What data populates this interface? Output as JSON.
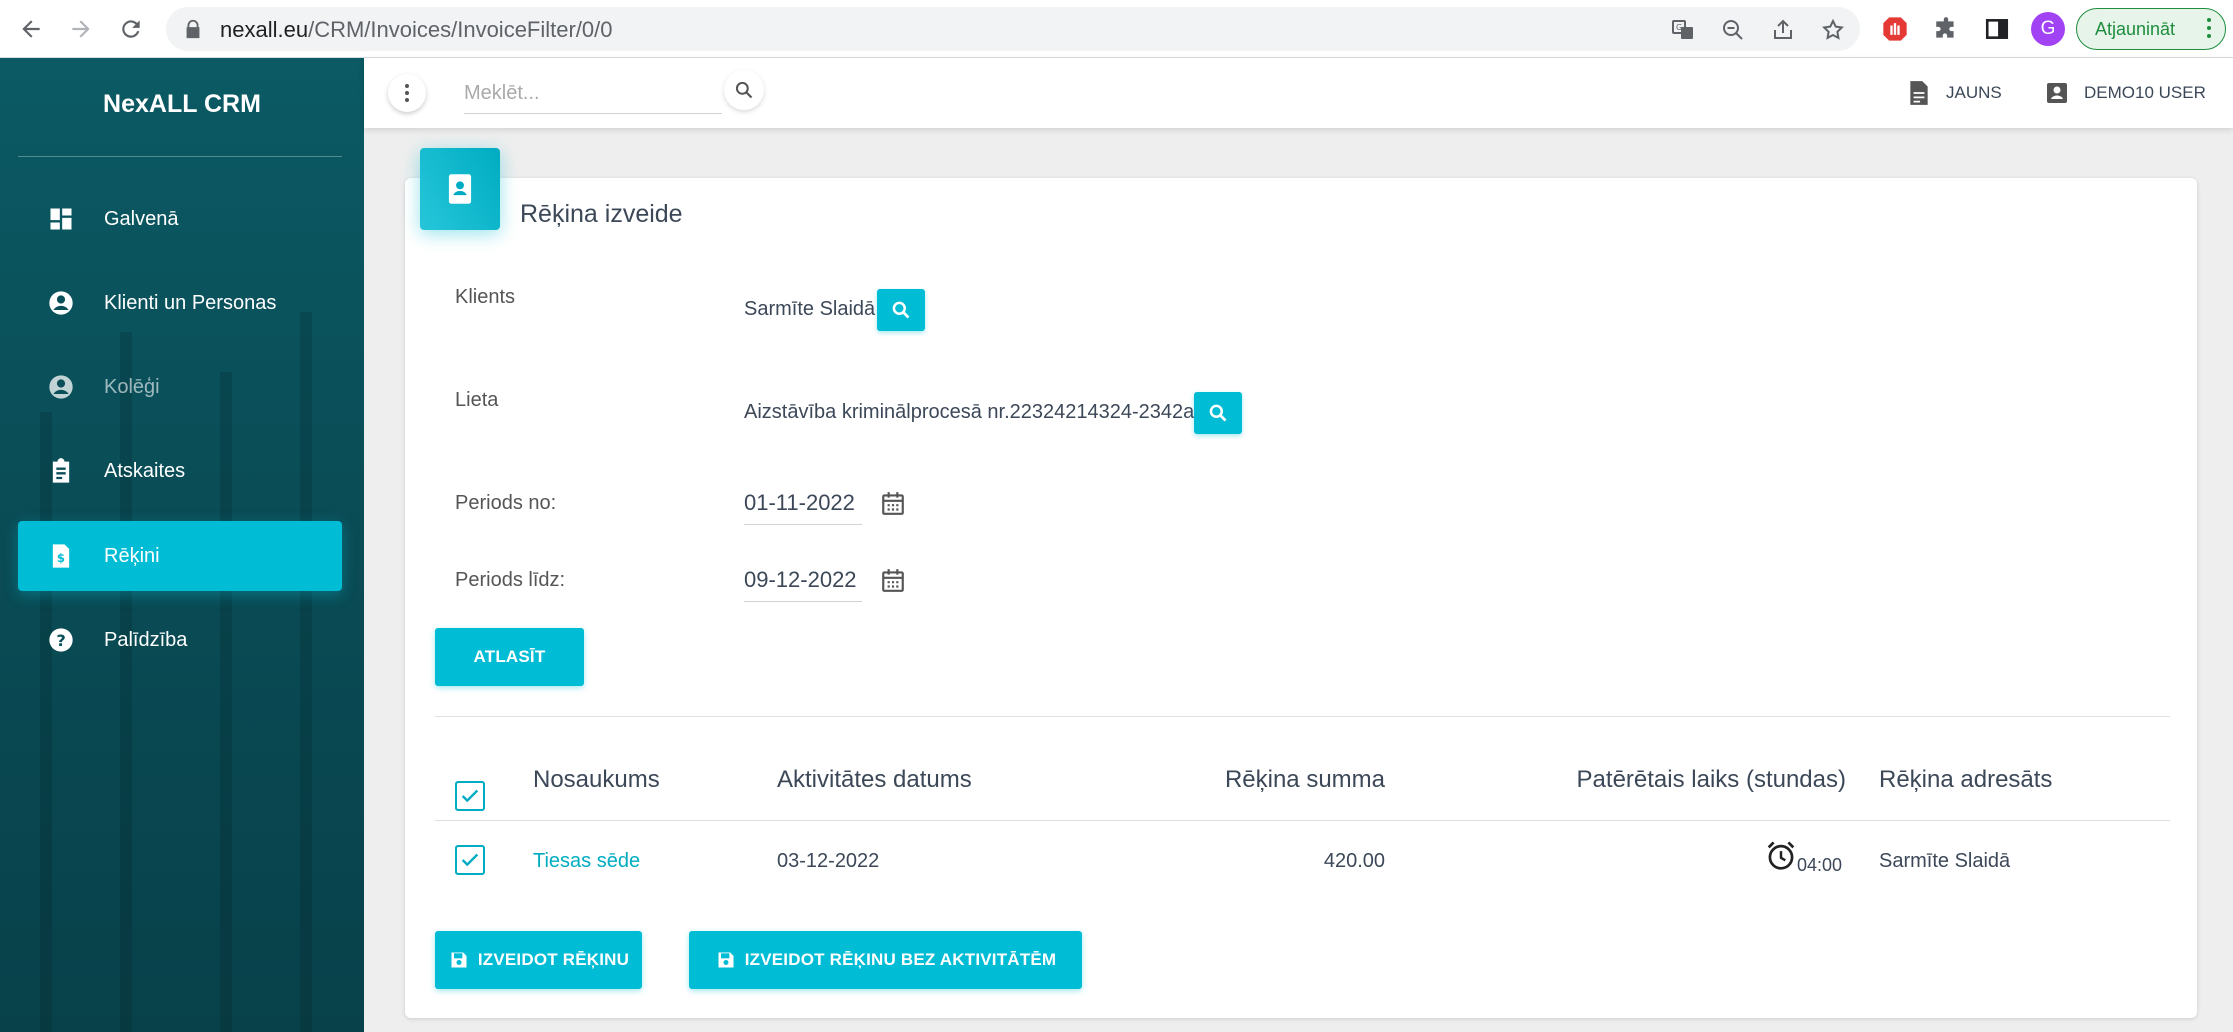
{
  "browser": {
    "url_host": "nexall.eu",
    "url_path": "/CRM/Invoices/InvoiceFilter/0/0",
    "profile_initial": "G",
    "update_label": "Atjaunināt"
  },
  "sidebar": {
    "brand": "NexALL CRM",
    "items": [
      {
        "label": "Galvenā",
        "icon": "dashboard-icon"
      },
      {
        "label": "Klienti un Personas",
        "icon": "account-circle-icon"
      },
      {
        "label": "Kolēģi",
        "icon": "account-circle-icon"
      },
      {
        "label": "Atskaites",
        "icon": "clipboard-icon"
      },
      {
        "label": "Rēķini",
        "icon": "invoice-dollar-icon",
        "active": true
      },
      {
        "label": "Palīdzība",
        "icon": "help-icon"
      }
    ]
  },
  "topbar": {
    "search_placeholder": "Meklēt...",
    "new_label": "JAUNS",
    "user_label": "DEMO10 USER"
  },
  "card": {
    "title": "Rēķina izveide",
    "client_label": "Klients",
    "client_value": "Sarmīte Slaidā",
    "case_label": "Lieta",
    "case_value": "Aizstāvība kriminālprocesā nr.22324214324-2342a",
    "period_from_label": "Periods no:",
    "period_from_value": "01-11-2022",
    "period_to_label": "Periods līdz:",
    "period_to_value": "09-12-2022",
    "filter_button": "ATLASĪT"
  },
  "table": {
    "headers": {
      "name": "Nosaukums",
      "date": "Aktivitātes datums",
      "amount": "Rēķina summa",
      "time": "Patērētais laiks (stundas)",
      "recipient": "Rēķina adresāts"
    },
    "rows": [
      {
        "name": "Tiesas sēde",
        "date": "03-12-2022",
        "amount": "420.00",
        "time": "04:00",
        "recipient": "Sarmīte Slaidā",
        "checked": true
      }
    ]
  },
  "actions": {
    "create_invoice": "IZVEIDOT RĒĶINU",
    "create_invoice_no_activities": "IZVEIDOT RĒĶINU BEZ AKTIVITĀTĒM"
  },
  "colors": {
    "accent": "#00bcd4",
    "sidebar_bg": "#0a4e58"
  }
}
